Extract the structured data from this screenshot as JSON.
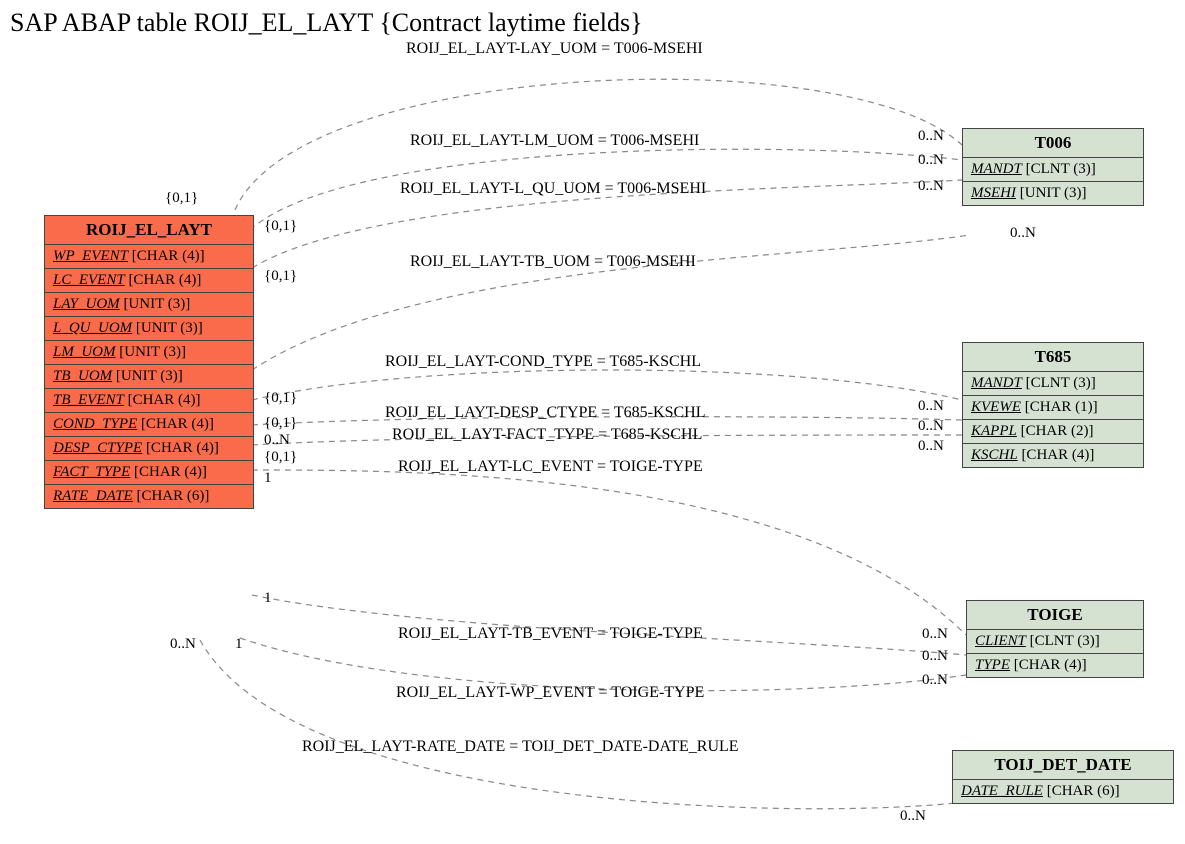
{
  "title": "SAP ABAP table ROIJ_EL_LAYT {Contract laytime fields}",
  "entities": {
    "main": {
      "name": "ROIJ_EL_LAYT",
      "fields": [
        {
          "name": "WP_EVENT",
          "type": "[CHAR (4)]"
        },
        {
          "name": "LC_EVENT",
          "type": "[CHAR (4)]"
        },
        {
          "name": "LAY_UOM",
          "type": "[UNIT (3)]"
        },
        {
          "name": "L_QU_UOM",
          "type": "[UNIT (3)]"
        },
        {
          "name": "LM_UOM",
          "type": "[UNIT (3)]"
        },
        {
          "name": "TB_UOM",
          "type": "[UNIT (3)]"
        },
        {
          "name": "TB_EVENT",
          "type": "[CHAR (4)]"
        },
        {
          "name": "COND_TYPE",
          "type": "[CHAR (4)]"
        },
        {
          "name": "DESP_CTYPE",
          "type": "[CHAR (4)]"
        },
        {
          "name": "FACT_TYPE",
          "type": "[CHAR (4)]"
        },
        {
          "name": "RATE_DATE",
          "type": "[CHAR (6)]"
        }
      ]
    },
    "t006": {
      "name": "T006",
      "fields": [
        {
          "name": "MANDT",
          "type": "[CLNT (3)]"
        },
        {
          "name": "MSEHI",
          "type": "[UNIT (3)]"
        }
      ]
    },
    "t685": {
      "name": "T685",
      "fields": [
        {
          "name": "MANDT",
          "type": "[CLNT (3)]"
        },
        {
          "name": "KVEWE",
          "type": "[CHAR (1)]"
        },
        {
          "name": "KAPPL",
          "type": "[CHAR (2)]"
        },
        {
          "name": "KSCHL",
          "type": "[CHAR (4)]"
        }
      ]
    },
    "toige": {
      "name": "TOIGE",
      "fields": [
        {
          "name": "CLIENT",
          "type": "[CLNT (3)]"
        },
        {
          "name": "TYPE",
          "type": "[CHAR (4)]"
        }
      ]
    },
    "toij": {
      "name": "TOIJ_DET_DATE",
      "fields": [
        {
          "name": "DATE_RULE",
          "type": "[CHAR (6)]"
        }
      ]
    }
  },
  "relations": {
    "r1": "ROIJ_EL_LAYT-LAY_UOM = T006-MSEHI",
    "r2": "ROIJ_EL_LAYT-LM_UOM = T006-MSEHI",
    "r3": "ROIJ_EL_LAYT-L_QU_UOM = T006-MSEHI",
    "r4": "ROIJ_EL_LAYT-TB_UOM = T006-MSEHI",
    "r5": "ROIJ_EL_LAYT-COND_TYPE = T685-KSCHL",
    "r6": "ROIJ_EL_LAYT-DESP_CTYPE = T685-KSCHL",
    "r7": "ROIJ_EL_LAYT-FACT_TYPE = T685-KSCHL",
    "r8": "ROIJ_EL_LAYT-LC_EVENT = TOIGE-TYPE",
    "r9": "ROIJ_EL_LAYT-TB_EVENT = TOIGE-TYPE",
    "r10": "ROIJ_EL_LAYT-WP_EVENT = TOIGE-TYPE",
    "r11": "ROIJ_EL_LAYT-RATE_DATE = TOIJ_DET_DATE-DATE_RULE"
  },
  "cards": {
    "c_01_a": "{0,1}",
    "c_01_b": "{0,1}",
    "c_01_c": "{0,1}",
    "c_01_d": "{0,1}",
    "c_01_e": "{0,1}",
    "c_01_f": "{0,1}",
    "c_0n_a": "0..N",
    "c_0n_b": "0..N",
    "c_0n_c": "0..N",
    "c_0n_d": "0..N",
    "c_0n_e": "0..N",
    "c_0n_f": "0..N",
    "c_0n_g": "0..N",
    "c_0n_h": "0..N",
    "c_0n_i": "0..N",
    "c_0n_j": "0..N",
    "c_0n_k": "0..N",
    "c_0n_left": "0..N",
    "c_0n_leftmid": "0..N",
    "c_1_a": "1",
    "c_1_b": "1",
    "c_1_c": "1"
  }
}
